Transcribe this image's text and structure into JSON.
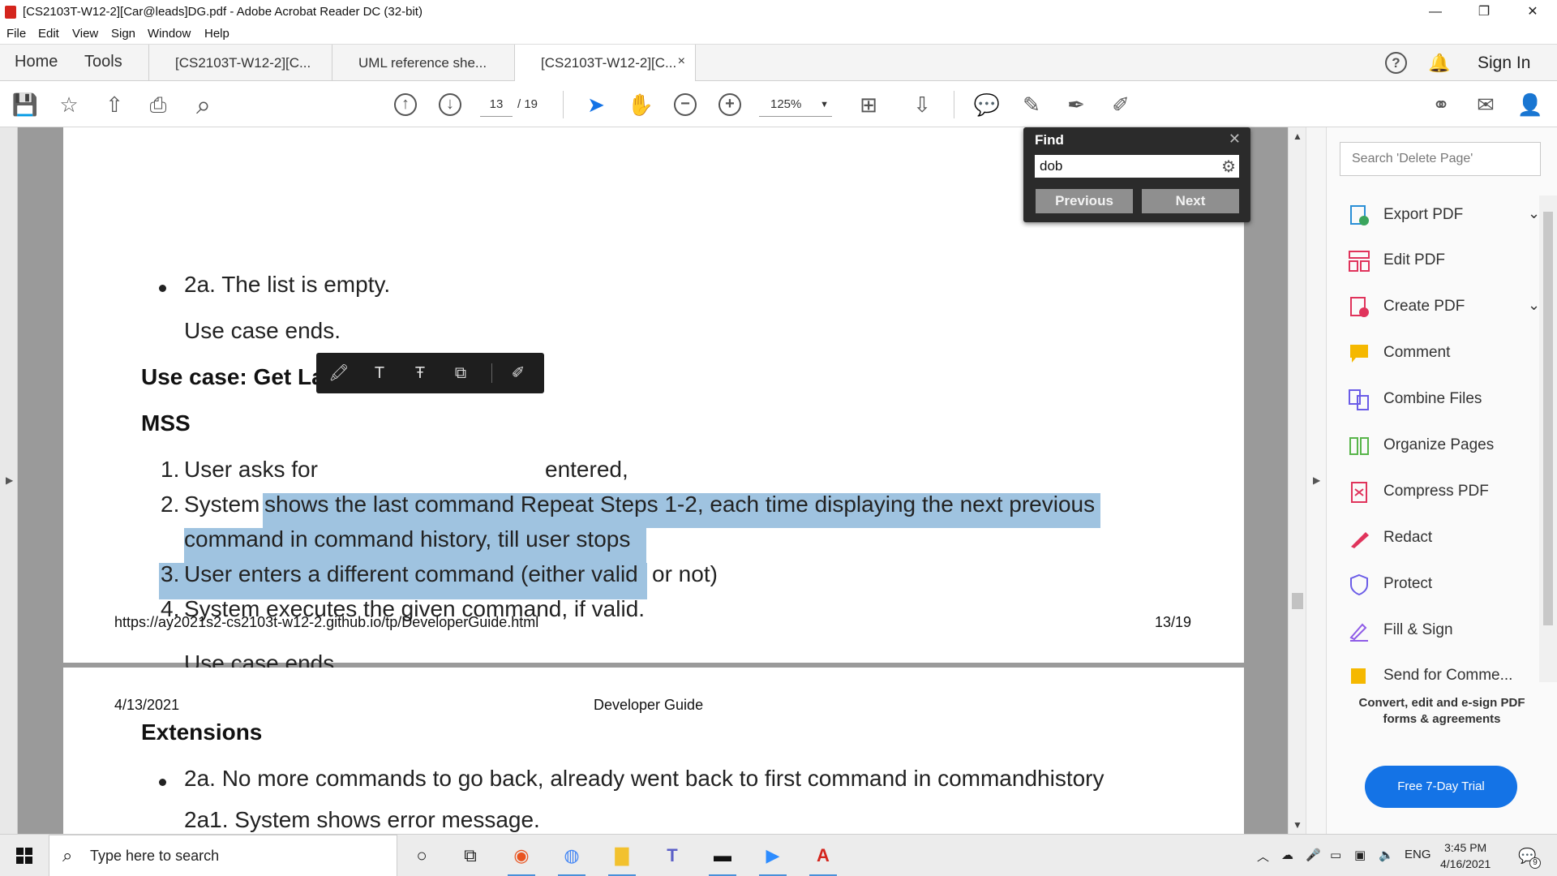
{
  "window": {
    "title": "[CS2103T-W12-2][Car@leads]DG.pdf - Adobe Acrobat Reader DC (32-bit)",
    "minimize": "—",
    "restore": "❐",
    "close": "✕"
  },
  "menu": [
    "File",
    "Edit",
    "View",
    "Sign",
    "Window",
    "Help"
  ],
  "tabs": {
    "home": "Home",
    "tools": "Tools",
    "docs": [
      {
        "label": "[CS2103T-W12-2][C..."
      },
      {
        "label": "UML reference she..."
      },
      {
        "label": "[CS2103T-W12-2][C..."
      }
    ],
    "close_glyph": "×",
    "help_glyph": "?",
    "bell_glyph": "🔔",
    "sign_in": "Sign In"
  },
  "toolbar": {
    "page_current": "13",
    "page_total": "/ 19",
    "zoom": "125%",
    "zoom_dd": "▼",
    "glyphs": {
      "save": "💾",
      "star": "☆",
      "upload": "⇧",
      "print": "⎙",
      "search": "⌕",
      "prev_page": "↑",
      "next_page": "↓",
      "select": "➤",
      "hand": "✋",
      "zoom_out": "−",
      "zoom_in": "+",
      "fit": "⊞",
      "scroll": "⇩",
      "comment": "💬",
      "pen": "✎",
      "sign": "✒",
      "edit": "✐",
      "share": "⚭",
      "mail": "✉",
      "adduser": "👤"
    }
  },
  "document": {
    "page1": {
      "bullet_2a": "2a. The list is empty.",
      "use_case_ends_1": "Use case ends.",
      "heading": "Use case: Get Last Command",
      "mss": "MSS",
      "step1_num": "1.",
      "step1_text_a": "User asks for",
      "step1_text_b": "entered,",
      "step2_num": "2.",
      "step2_line1_a": "System",
      "step2_line1_b": "shows the last command Repeat Steps 1-2, each time displaying the next previous",
      "step2_line2": "command in command history, till user stops",
      "step3_num": "3.",
      "step3_text_a": "User enters a different command (either valid",
      "step3_text_b": "or not)",
      "step4_num": "4.",
      "step4_text": "System executes the given command, if valid.",
      "use_case_ends_2": "Use case ends.",
      "footer_url": "https://ay2021s2-cs2103t-w12-2.github.io/tp/DeveloperGuide.html",
      "footer_page": "13/19"
    },
    "page2": {
      "date": "4/13/2021",
      "header": "Developer Guide",
      "heading": "Extensions",
      "bullet_2a": "2a. No more commands to go back, already went back to first command in commandhistory",
      "line_2a1": "2a1. System shows error message."
    }
  },
  "annotation_toolbar": {
    "glyphs": {
      "highlight": "🖍",
      "underline": "T",
      "strike": "Ŧ",
      "copy": "⧉",
      "more": "✐"
    }
  },
  "find": {
    "title": "Find",
    "close_glyph": "✕",
    "query": "dob",
    "gear": "⚙",
    "previous": "Previous",
    "next": "Next"
  },
  "scroll": {
    "up": "▲",
    "down": "▼",
    "left_arrow": "▶",
    "right_arrow": "▶"
  },
  "right_panel": {
    "search_placeholder": "Search 'Delete Page'",
    "chevron": "⌄",
    "tools": [
      {
        "label": "Export PDF",
        "color": "#e0335b",
        "chevron": true
      },
      {
        "label": "Edit PDF",
        "color": "#e0335b",
        "chevron": false
      },
      {
        "label": "Create PDF",
        "color": "#e0335b",
        "chevron": true
      },
      {
        "label": "Comment",
        "color": "#f5b800",
        "chevron": false
      },
      {
        "label": "Combine Files",
        "color": "#6b5ce7",
        "chevron": false
      },
      {
        "label": "Organize Pages",
        "color": "#58b54a",
        "chevron": false
      },
      {
        "label": "Compress PDF",
        "color": "#e0335b",
        "chevron": false
      },
      {
        "label": "Redact",
        "color": "#e0335b",
        "chevron": false
      },
      {
        "label": "Protect",
        "color": "#6b5ce7",
        "chevron": false
      },
      {
        "label": "Fill & Sign",
        "color": "#8f5ce7",
        "chevron": false
      },
      {
        "label": "Send for Comme...",
        "color": "#f5b800",
        "chevron": false
      }
    ],
    "promo_line1": "Convert, edit and e-sign PDF",
    "promo_line2": "forms & agreements",
    "trial_button": "Free 7-Day Trial"
  },
  "taskbar": {
    "search_placeholder": "Type here to search",
    "search_glyph": "⌕",
    "time": "3:45 PM",
    "date": "4/16/2021",
    "lang": "ENG",
    "notifications": "9",
    "icons": {
      "cortana": "○",
      "taskview": "⧉",
      "ubuntu": "◉",
      "chrome": "◍",
      "explorer": "▇",
      "teams": "T",
      "terminal": "▬",
      "zoom": "▶",
      "acrobat": "A"
    },
    "tray": {
      "chevron": "︿",
      "cloud": "☁",
      "mic": "🎤",
      "battery": "▭",
      "network": "▣",
      "volume": "🔈",
      "notify": "💬"
    }
  },
  "colors": {
    "highlight": "#9fc3e0",
    "accent": "#1473e6",
    "acrobat_red": "#d4251d"
  }
}
